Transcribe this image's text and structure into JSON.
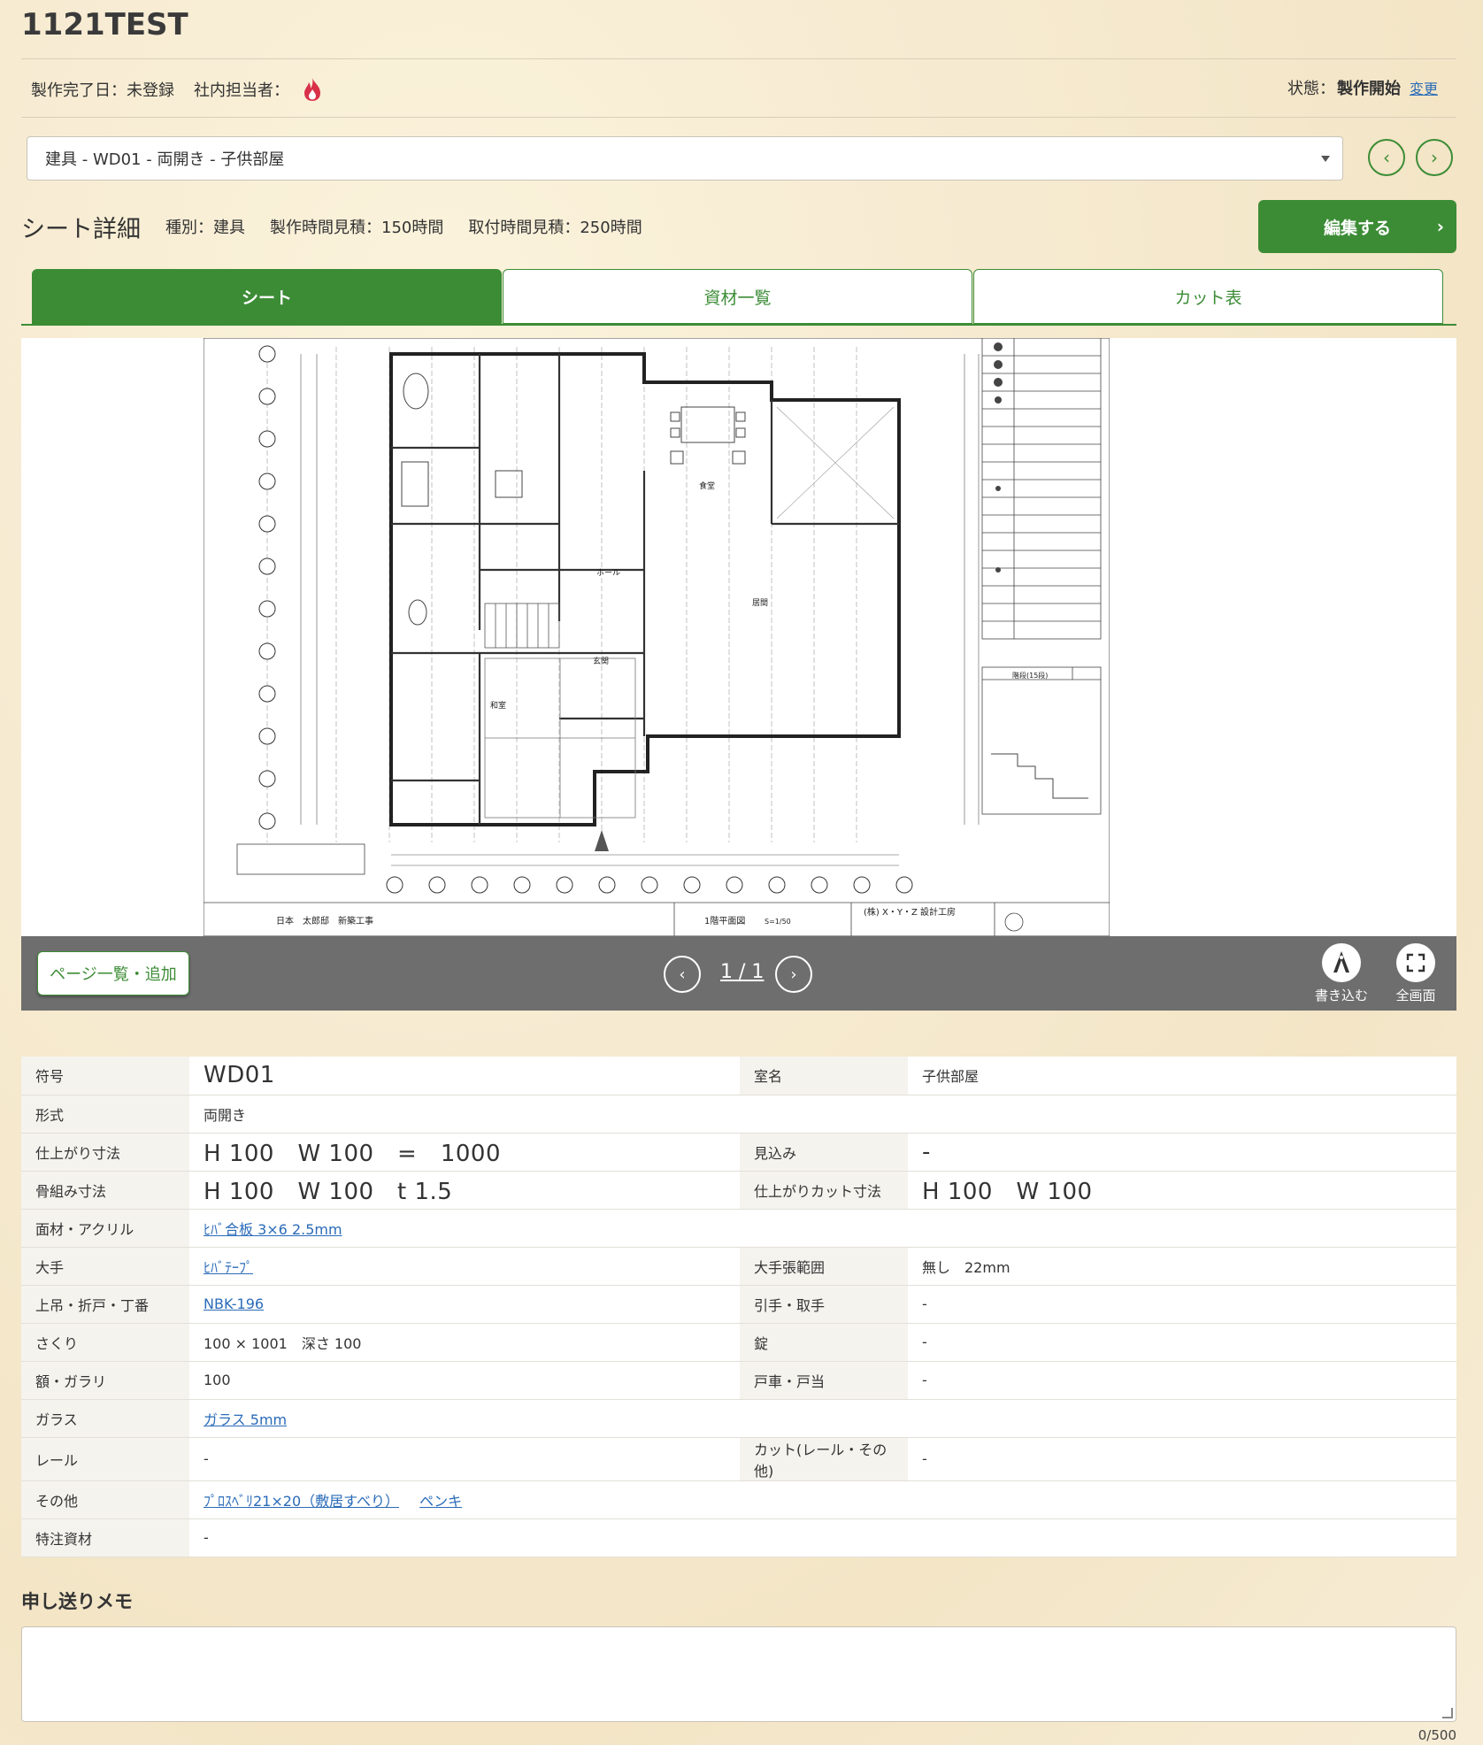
{
  "page": {
    "title": "1121TEST"
  },
  "meta": {
    "completion": "製作完了日：未登録",
    "owner": "社内担当者：",
    "status_label": "状態：",
    "status_value": "製作開始",
    "change_link": "変更"
  },
  "selector": {
    "value": "建具 - WD01 - 両開き - 子供部屋",
    "prev": "‹",
    "next": "›"
  },
  "sheet": {
    "heading": "シート詳細",
    "type": "種別：建具",
    "make_time": "製作時間見積：150時間",
    "install_time": "取付時間見積：250時間",
    "edit_label": "編集する",
    "edit_chevron": "›"
  },
  "tabs": [
    {
      "label": "シート",
      "active": true
    },
    {
      "label": "資材一覧",
      "active": false
    },
    {
      "label": "カット表",
      "active": false
    }
  ],
  "viewer": {
    "page_list_label": "ページ一覧・追加",
    "page_indicator": "1 / 1",
    "prev": "‹",
    "next": "›",
    "draw_label": "書き込む",
    "fullscreen_label": "全画面",
    "drawing_texts": {
      "owner": "日本　太郎邸　新築工事",
      "plan": "1階平面図",
      "scale": "S=1/50",
      "firm": "(株) X・Y・Z 設計工房",
      "room_living": "居間",
      "room_dining": "食堂",
      "room_hall": "ホール",
      "room_entrance": "玄関",
      "room_washitsu": "和室",
      "stairs_title": "階段(15段)"
    }
  },
  "spec": {
    "r1": {
      "k1": "符号",
      "v1": "WD01",
      "k2": "室名",
      "v2": "子供部屋"
    },
    "r2": {
      "k1": "形式",
      "v1": "両開き"
    },
    "r3": {
      "k1": "仕上がり寸法",
      "v1": "H 100　W 100　=　1000",
      "k2": "見込み",
      "v2": "-"
    },
    "r4": {
      "k1": "骨組み寸法",
      "v1": "H 100　W 100　t 1.5",
      "k2": "仕上がりカット寸法",
      "v2": "H 100　W 100"
    },
    "r5": {
      "k1": "面材・アクリル",
      "v1": "ﾋﾊﾞ合板 3×6 2.5mm"
    },
    "r6": {
      "k1": "大手",
      "v1": "ﾋﾊﾞﾃｰﾌﾟ",
      "k2": "大手張範囲",
      "v2": "無し　22mm"
    },
    "r7": {
      "k1": "上吊・折戸・丁番",
      "v1": "NBK-196",
      "k2": "引手・取手",
      "v2": "-"
    },
    "r8": {
      "k1": "さくり",
      "v1": "100 × 1001　深さ 100",
      "k2": "錠",
      "v2": "-"
    },
    "r9": {
      "k1": "額・ガラリ",
      "v1": "100",
      "k2": "戸車・戸当",
      "v2": "-"
    },
    "r10": {
      "k1": "ガラス",
      "v1": "ガラス 5mm"
    },
    "r11": {
      "k1": "レール",
      "v1": "-",
      "k2": "カット(レール・その他)",
      "v2": "-"
    },
    "r12": {
      "k1": "その他",
      "v1a": "ﾌﾟﾛｽﾍﾞﾘ21×20（敷居すべり）",
      "v1b": "ペンキ"
    },
    "r13": {
      "k1": "特注資材",
      "v1": "-"
    }
  },
  "memo": {
    "title": "申し送りメモ",
    "value": "",
    "counter": "0/500"
  },
  "colors": {
    "accent": "#3c8c36",
    "link": "#2a6bb8",
    "flame": "#d9304a",
    "bar": "#6e6e6e"
  }
}
